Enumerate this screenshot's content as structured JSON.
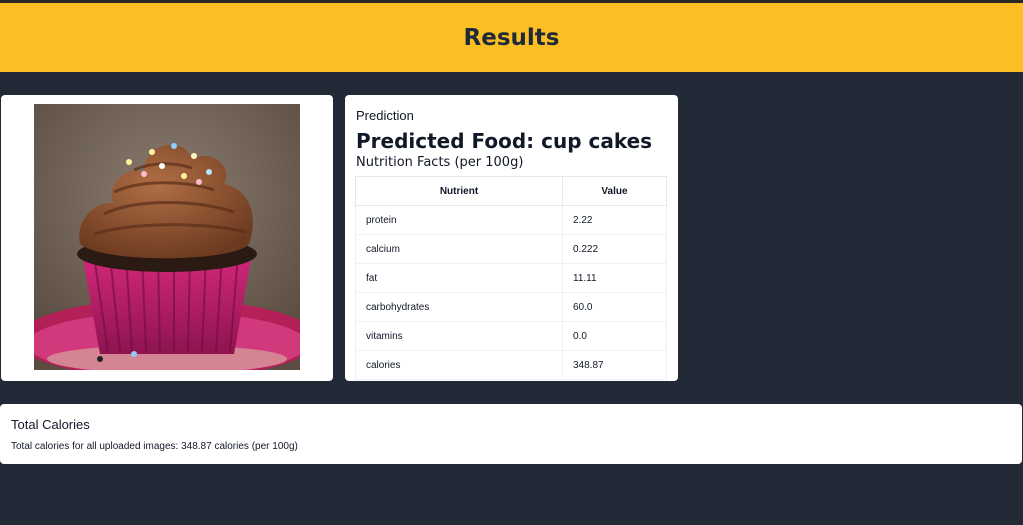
{
  "header": {
    "title": "Results"
  },
  "image": {
    "alt": "cup cakes"
  },
  "prediction": {
    "label": "Prediction",
    "title": "Predicted Food: cup cakes",
    "facts_title": "Nutrition Facts (per 100g)",
    "table": {
      "headers": [
        "Nutrient",
        "Value"
      ],
      "rows": [
        [
          "protein",
          "2.22"
        ],
        [
          "calcium",
          "0.222"
        ],
        [
          "fat",
          "11.11"
        ],
        [
          "carbohydrates",
          "60.0"
        ],
        [
          "vitamins",
          "0.0"
        ],
        [
          "calories",
          "348.87"
        ]
      ]
    }
  },
  "total": {
    "title": "Total Calories",
    "text": "Total calories for all uploaded images: 348.87 calories (per 100g)"
  },
  "colors": {
    "header_bg": "#fbbf24",
    "page_bg": "#222a38",
    "card_bg": "#ffffff"
  }
}
